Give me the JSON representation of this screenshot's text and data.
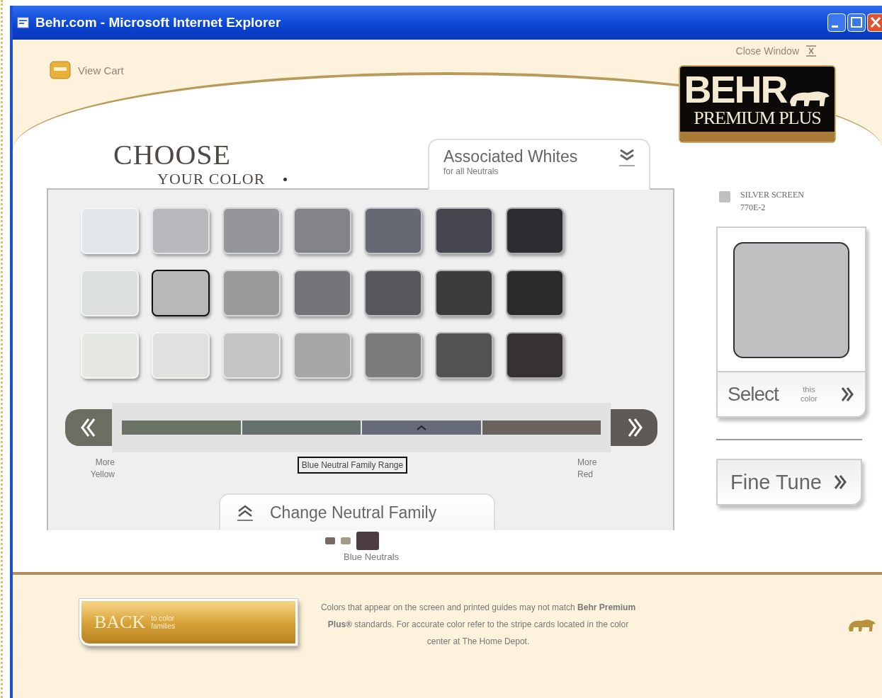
{
  "window": {
    "title": "Behr.com - Microsoft Internet Explorer"
  },
  "header": {
    "view_cart": "View Cart",
    "close_window": "Close Window",
    "logo": {
      "brand": "BEHR",
      "line": "PREMIUM PLUS"
    }
  },
  "heading": {
    "line1": "CHOOSE",
    "line2": "YOUR COLOR"
  },
  "whites_tab": {
    "title": "Associated Whites",
    "subtitle": "for all Neutrals"
  },
  "swatches": [
    {
      "color": "#e3e6ea",
      "selected": false
    },
    {
      "color": "#b9b9bd",
      "selected": false
    },
    {
      "color": "#95969a",
      "selected": false
    },
    {
      "color": "#838489",
      "selected": false
    },
    {
      "color": "#666873",
      "selected": false
    },
    {
      "color": "#45464e",
      "selected": false
    },
    {
      "color": "#2d2d31",
      "selected": false
    },
    {
      "color": "#dcdfe0",
      "selected": false
    },
    {
      "color": "#b8b8ba",
      "selected": true
    },
    {
      "color": "#9a9a9b",
      "selected": false
    },
    {
      "color": "#737579",
      "selected": false
    },
    {
      "color": "#56575a",
      "selected": false
    },
    {
      "color": "#3c3c3e",
      "selected": false
    },
    {
      "color": "#2a2a2b",
      "selected": false
    },
    {
      "color": "#e6e9e3",
      "selected": false
    },
    {
      "color": "#e0e1de",
      "selected": false
    },
    {
      "color": "#c5c5c5",
      "selected": false
    },
    {
      "color": "#a6a6a6",
      "selected": false
    },
    {
      "color": "#7c7c7c",
      "selected": false
    },
    {
      "color": "#535252",
      "selected": false
    },
    {
      "color": "#363233",
      "selected": false
    }
  ],
  "range": {
    "segments": [
      {
        "color": "#6a7365",
        "selected": false
      },
      {
        "color": "#66716f",
        "selected": false
      },
      {
        "color": "#676a78",
        "selected": true
      },
      {
        "color": "#6a625e",
        "selected": false
      }
    ],
    "left_label": "More Yellow",
    "right_label": "More Red",
    "caption": "Blue Neutral Family Range"
  },
  "family_tab": {
    "title": "Change Neutral Family"
  },
  "families": [
    {
      "color": "#7a6a66",
      "selected": false
    },
    {
      "color": "#a59a8a",
      "selected": false
    },
    {
      "color": "#4e3e43",
      "selected": true
    }
  ],
  "family_name": "Blue Neutrals",
  "selected_color": {
    "name": "SILVER SCREEN",
    "code": "770E-2",
    "color": "#c0c0c2"
  },
  "select_button": {
    "label": "Select",
    "sub": "this color"
  },
  "fine_tune": "Fine Tune",
  "back_button": {
    "label": "BACK",
    "sub": "to color families"
  },
  "disclaimer": "Colors that appear on the screen and printed guides may not match **Behr Premium Plus®** standards. For accurate color refer to the stripe cards located in the color center at The Home Depot."
}
